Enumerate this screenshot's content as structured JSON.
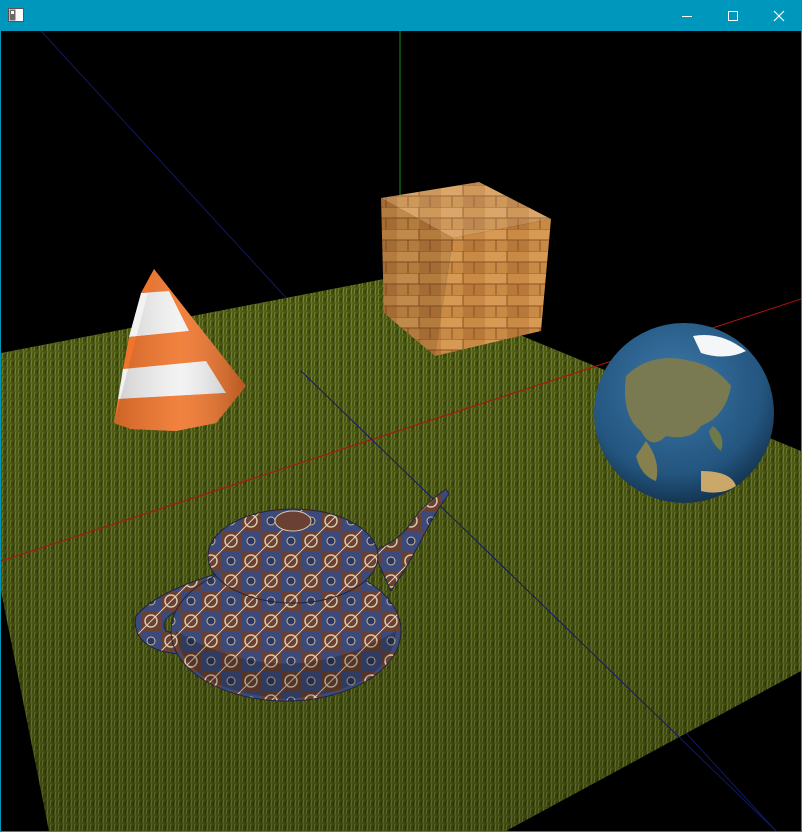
{
  "window": {
    "title": "",
    "controls": {
      "minimize_icon": "minimize-icon",
      "maximize_icon": "maximize-icon",
      "close_icon": "close-icon"
    }
  },
  "scene": {
    "background_color": "#000000",
    "objects": [
      {
        "name": "grass-ground-plane",
        "texture": "grass",
        "color": "#5b6a1e"
      },
      {
        "name": "traffic-cone",
        "texture": "orange-white-stripes",
        "color": "#f0742a"
      },
      {
        "name": "wooden-crate",
        "texture": "wood-planks",
        "color": "#c98a45"
      },
      {
        "name": "earth-globe",
        "texture": "earth",
        "color": "#2a5f8c"
      },
      {
        "name": "teapot",
        "texture": "patterned-fabric",
        "color": "#3b4a7a"
      }
    ],
    "axes": {
      "x_color": "#b01010",
      "y_color": "#10a010",
      "z_color": "#101a60"
    }
  }
}
